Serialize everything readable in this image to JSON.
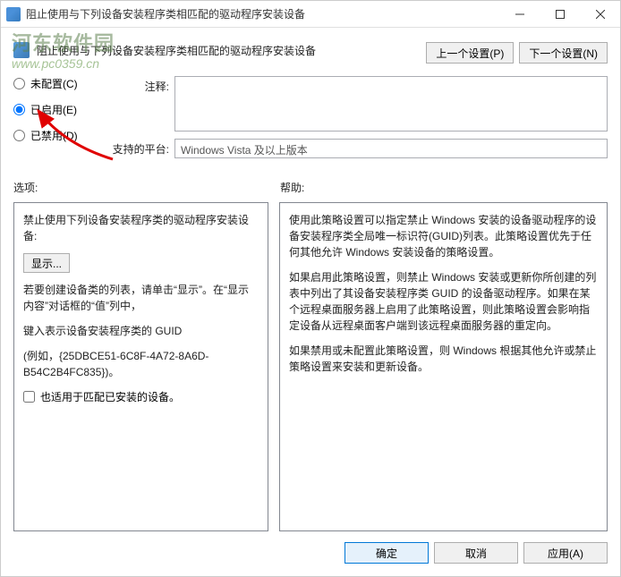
{
  "window": {
    "title": "阻止使用与下列设备安装程序类相匹配的驱动程序安装设备"
  },
  "watermark": {
    "cn": "河东软件园",
    "url": "www.pc0359.cn"
  },
  "header": {
    "title": "阻止使用与下列设备安装程序类相匹配的驱动程序安装设备",
    "prev": "上一个设置(P)",
    "next": "下一个设置(N)"
  },
  "radios": {
    "not_configured": "未配置(C)",
    "enabled": "已启用(E)",
    "disabled": "已禁用(D)",
    "selected": "enabled"
  },
  "fields": {
    "comment_label": "注释:",
    "comment_value": "",
    "platform_label": "支持的平台:",
    "platform_value": "Windows Vista 及以上版本"
  },
  "labels": {
    "options": "选项:",
    "help": "帮助:"
  },
  "options_panel": {
    "line1": "禁止使用下列设备安装程序类的驱动程序安装设备:",
    "show_btn": "显示...",
    "line2": "若要创建设备类的列表，请单击“显示”。在“显示内容”对话框的“值”列中，",
    "line3": "键入表示设备安装程序类的 GUID",
    "line4": "(例如，{25DBCE51-6C8F-4A72-8A6D-B54C2B4FC835})。",
    "checkbox_label": "也适用于匹配已安装的设备。",
    "checkbox_checked": false
  },
  "help_panel": {
    "p1": "使用此策略设置可以指定禁止 Windows 安装的设备驱动程序的设备安装程序类全局唯一标识符(GUID)列表。此策略设置优先于任何其他允许 Windows 安装设备的策略设置。",
    "p2": "如果启用此策略设置，则禁止 Windows 安装或更新你所创建的列表中列出了其设备安装程序类 GUID 的设备驱动程序。如果在某个远程桌面服务器上启用了此策略设置，则此策略设置会影响指定设备从远程桌面客户端到该远程桌面服务器的重定向。",
    "p3": "如果禁用或未配置此策略设置，则 Windows 根据其他允许或禁止策略设置来安装和更新设备。"
  },
  "buttons": {
    "ok": "确定",
    "cancel": "取消",
    "apply": "应用(A)"
  }
}
